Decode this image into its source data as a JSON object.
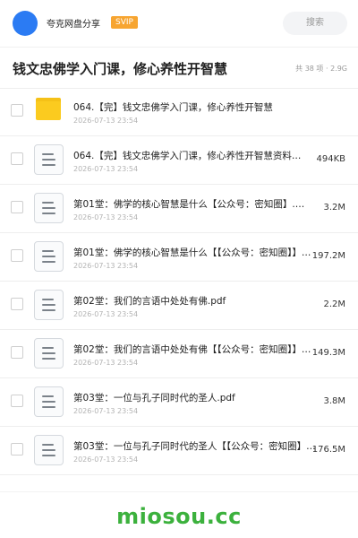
{
  "header": {
    "user_name": "夸克网盘分享",
    "badge": "SVIP",
    "search_placeholder": "搜索"
  },
  "title_row": {
    "title": "钱文忠佛学入门课，修心养性开智慧",
    "summary": "共 38 项 · 2.9G"
  },
  "files": [
    {
      "type": "folder",
      "name": "064.【完】钱文忠佛学入门课，修心养性开智慧",
      "date": "2026-07-13 23:54",
      "size": ""
    },
    {
      "type": "doc",
      "name": "064.【完】钱文忠佛学入门课，修心养性开智慧资料…",
      "date": "2026-07-13 23:54",
      "size": "494KB"
    },
    {
      "type": "doc",
      "name": "第01堂：佛学的核心智慧是什么【公众号：密知圈】.…",
      "date": "2026-07-13 23:54",
      "size": "3.2M"
    },
    {
      "type": "doc",
      "name": "第01堂：佛学的核心智慧是什么【【公众号：密知圈】】…",
      "date": "2026-07-13 23:54",
      "size": "197.2M"
    },
    {
      "type": "doc",
      "name": "第02堂：我们的言语中处处有佛.pdf",
      "date": "2026-07-13 23:54",
      "size": "2.2M"
    },
    {
      "type": "doc",
      "name": "第02堂：我们的言语中处处有佛【【公众号：密知圈】】…",
      "date": "2026-07-13 23:54",
      "size": "149.3M"
    },
    {
      "type": "doc",
      "name": "第03堂：一位与孔子同时代的圣人.pdf",
      "date": "2026-07-13 23:54",
      "size": "3.8M"
    },
    {
      "type": "doc",
      "name": "第03堂：一位与孔子同时代的圣人【【公众号：密知圈】…",
      "date": "2026-07-13 23:54",
      "size": "176.5M"
    }
  ],
  "footer": {
    "watermark": "miosou.cc"
  },
  "colors": {
    "avatar": "#2b7bf3",
    "badge": "#f7a531",
    "folder": "#fbcb1f",
    "watermark": "#3cb13d"
  }
}
